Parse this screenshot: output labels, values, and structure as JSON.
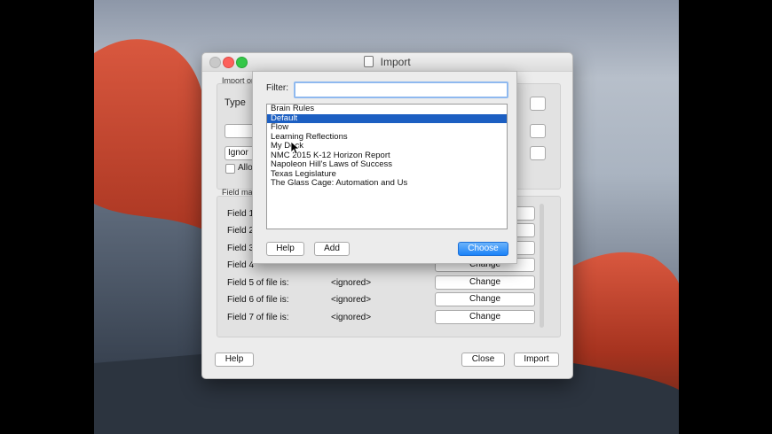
{
  "import_window": {
    "title": "Import",
    "import_options_label": "Import op",
    "type_label": "Type",
    "ignore_label": "Ignor",
    "allow_label": "Allo",
    "field_map_label": "Field map",
    "fields": [
      {
        "label": "Field 1",
        "value": "",
        "button": "Change"
      },
      {
        "label": "Field 2",
        "value": "",
        "button": "Change"
      },
      {
        "label": "Field 3",
        "value": "",
        "button": "Change"
      },
      {
        "label": "Field 4",
        "value": "",
        "button": "Change"
      },
      {
        "label": "Field 5 of file is:",
        "value": "<ignored>",
        "button": "Change"
      },
      {
        "label": "Field 6 of file is:",
        "value": "<ignored>",
        "button": "Change"
      },
      {
        "label": "Field 7 of file is:",
        "value": "<ignored>",
        "button": "Change"
      }
    ],
    "help_button": "Help",
    "close_button": "Close",
    "import_button": "Import"
  },
  "sheet": {
    "filter_label": "Filter:",
    "filter_value": "",
    "items": [
      "Brain Rules",
      "Default",
      "Flow",
      "Learning Reflections",
      "My Deck",
      "NMC 2015 K-12 Horizon Report",
      "Napoleon Hill's Laws of Success",
      "Texas Legislature",
      "The Glass Cage: Automation and Us"
    ],
    "selected_index": 1,
    "help_button": "Help",
    "add_button": "Add",
    "choose_button": "Choose"
  }
}
